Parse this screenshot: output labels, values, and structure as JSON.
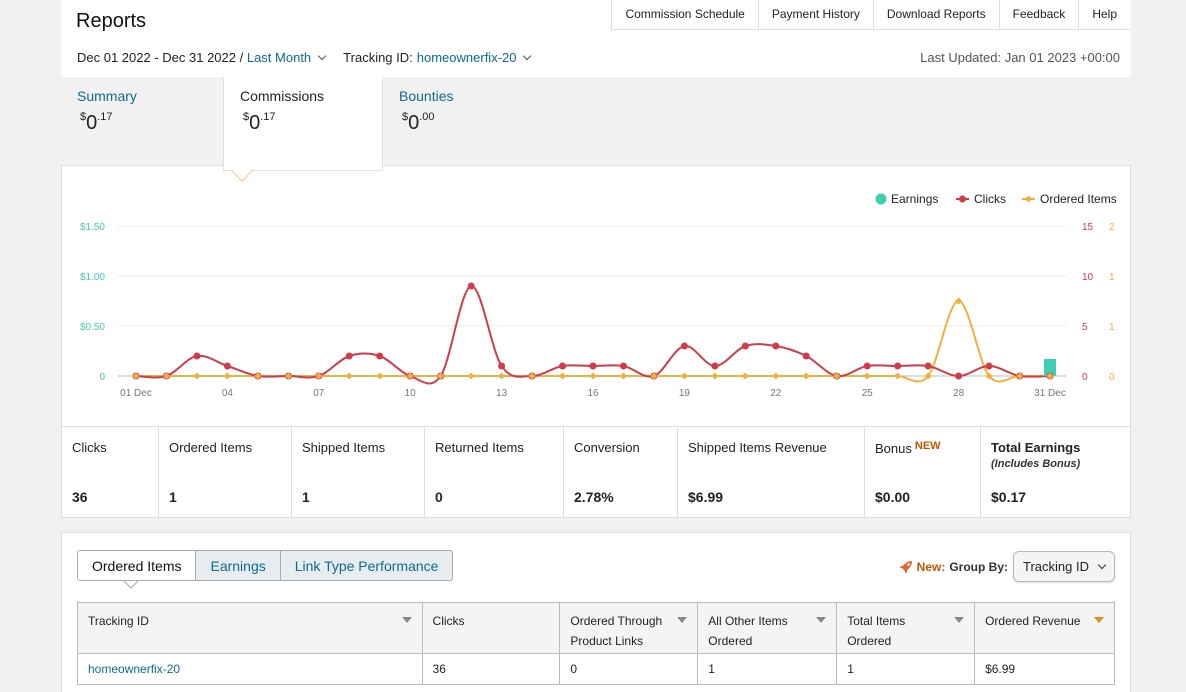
{
  "header": {
    "title": "Reports",
    "nav": [
      "Commission Schedule",
      "Payment History",
      "Download Reports",
      "Feedback",
      "Help"
    ],
    "date_range": "Dec 01 2022 - Dec 31 2022",
    "period": "Last Month",
    "tracking_label": "Tracking ID:",
    "tracking_id": "homeownerfix-20",
    "last_updated": "Last Updated: Jan 01 2023 +00:00"
  },
  "summary_tabs": [
    {
      "label": "Summary",
      "currency": "$",
      "whole": "0",
      "fraction": ".17"
    },
    {
      "label": "Commissions",
      "currency": "$",
      "whole": "0",
      "fraction": ".17"
    },
    {
      "label": "Bounties",
      "currency": "$",
      "whole": "0",
      "fraction": ".00"
    }
  ],
  "colors": {
    "earnings": "#3ecfb2",
    "clicks": "#cf3c4a",
    "ordered": "#f0b13c",
    "link": "#0e6b8a",
    "new": "#c45500"
  },
  "chart_data": {
    "type": "line",
    "legend": [
      "Earnings",
      "Clicks",
      "Ordered Items"
    ],
    "legend_position": "top-right",
    "x_tick_labels": [
      "01 Dec",
      "04",
      "07",
      "10",
      "13",
      "16",
      "19",
      "22",
      "25",
      "28",
      "31 Dec"
    ],
    "y_left_ticks": [
      "0",
      "$0.50",
      "$1.00",
      "$1.50"
    ],
    "y_right_ticks_clicks": [
      "0",
      "5",
      "10",
      "15"
    ],
    "y_right_ticks_ordered": [
      "0",
      "1",
      "1",
      "2"
    ],
    "ylim_earnings": [
      0,
      1.5
    ],
    "ylim_clicks": [
      0,
      15
    ],
    "ylim_ordered": [
      0,
      2
    ],
    "days": [
      1,
      2,
      3,
      4,
      5,
      6,
      7,
      8,
      9,
      10,
      11,
      12,
      13,
      14,
      15,
      16,
      17,
      18,
      19,
      20,
      21,
      22,
      23,
      24,
      25,
      26,
      27,
      28,
      29,
      30,
      31
    ],
    "series": [
      {
        "name": "Clicks",
        "values": [
          0,
          0,
          2,
          1,
          0,
          0,
          0,
          2,
          2,
          0,
          0,
          9,
          1,
          0,
          1,
          1,
          1,
          0,
          3,
          1,
          3,
          3,
          2,
          0,
          1,
          1,
          1,
          0,
          1,
          0,
          0
        ]
      },
      {
        "name": "Ordered Items",
        "values": [
          0,
          0,
          0,
          0,
          0,
          0,
          0,
          0,
          0,
          0,
          0,
          0,
          0,
          0,
          0,
          0,
          0,
          0,
          0,
          0,
          0,
          0,
          0,
          0,
          0,
          0,
          0,
          1,
          0,
          0,
          0
        ]
      },
      {
        "name": "Earnings",
        "values": [
          0,
          0,
          0,
          0,
          0,
          0,
          0,
          0,
          0,
          0,
          0,
          0,
          0,
          0,
          0,
          0,
          0,
          0,
          0,
          0,
          0,
          0,
          0,
          0,
          0,
          0,
          0,
          0,
          0,
          0,
          0.17
        ]
      }
    ]
  },
  "metrics": [
    {
      "label": "Clicks",
      "value": "36"
    },
    {
      "label": "Ordered Items",
      "value": "1"
    },
    {
      "label": "Shipped Items",
      "value": "1"
    },
    {
      "label": "Returned Items",
      "value": "0"
    },
    {
      "label": "Conversion",
      "value": "2.78%"
    },
    {
      "label": "Shipped Items Revenue",
      "value": "$6.99"
    },
    {
      "label": "Bonus",
      "badge": "NEW",
      "value": "$0.00"
    },
    {
      "label": "Total Earnings",
      "sub": "(Includes Bonus)",
      "value": "$0.17"
    }
  ],
  "bottom": {
    "tabs": [
      "Ordered Items",
      "Earnings",
      "Link Type Performance"
    ],
    "new_label": "New:",
    "group_by_label": "Group By:",
    "group_by_value": "Tracking ID",
    "columns": [
      "Tracking ID",
      "Clicks",
      "Ordered Through Product Links",
      "All Other Items Ordered",
      "Total Items Ordered",
      "Ordered Revenue"
    ],
    "rows": [
      [
        "homeownerfix-20",
        "36",
        "0",
        "1",
        "1",
        "$6.99"
      ]
    ]
  }
}
